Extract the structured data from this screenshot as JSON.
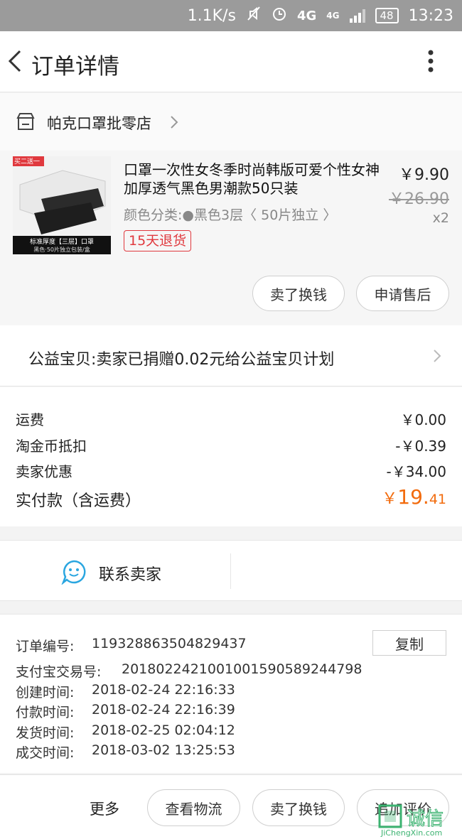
{
  "status_bar": {
    "speed": "1.1K/s",
    "network_4g_1": "4G",
    "network_4g_2": "4G",
    "battery": "48",
    "time": "13:23"
  },
  "header": {
    "title": "订单详情"
  },
  "shop": {
    "name": "帕克口罩批零店"
  },
  "product": {
    "image_tag": "买二送一",
    "image_caption": "标准厚度【三层】口罩",
    "image_subcaption": "黑色·50片独立包装/盒",
    "title": "口罩一次性女冬季时尚韩版可爱个性女神加厚透气黑色男潮款50只装",
    "spec": "颜色分类:●黑色3层〈 50片独立 〉",
    "return_badge": "15天退货",
    "price": "￥9.90",
    "original_price": "￥26.90",
    "quantity": "x2",
    "sell_button": "卖了换钱",
    "after_sale_button": "申请售后"
  },
  "charity": {
    "text": "公益宝贝:卖家已捐赠0.02元给公益宝贝计划"
  },
  "fees": {
    "shipping_label": "运费",
    "shipping_value": "￥0.00",
    "coin_label": "淘金币抵扣",
    "coin_value": "-￥0.39",
    "seller_discount_label": "卖家优惠",
    "seller_discount_value": "-￥34.00",
    "total_label": "实付款（含运费）",
    "total_currency": "￥",
    "total_integer": "19.",
    "total_decimal": "41"
  },
  "contact": {
    "label": "联系卖家"
  },
  "order_info": {
    "order_no_label": "订单编号:",
    "order_no_value": "119328863504829437",
    "copy_button": "复制",
    "alipay_label": "支付宝交易号:",
    "alipay_value": "2018022421001001590589244798",
    "created_label": "创建时间:",
    "created_value": "2018-02-24 22:16:33",
    "paid_label": "付款时间:",
    "paid_value": "2018-02-24 22:16:39",
    "shipped_label": "发货时间:",
    "shipped_value": "2018-02-25 02:04:12",
    "completed_label": "成交时间:",
    "completed_value": "2018-03-02 13:25:53"
  },
  "bottom_bar": {
    "more": "更多",
    "logistics": "查看物流",
    "sell": "卖了换钱",
    "review": "追加评价"
  },
  "watermark": {
    "brand": "诚信",
    "url": "JiChengXin.com"
  },
  "colors": {
    "accent_orange": "#f26b0d",
    "badge_red": "#e0393e",
    "contact_blue": "#2aa6e0",
    "status_bar_gray": "#9b9b9b"
  }
}
